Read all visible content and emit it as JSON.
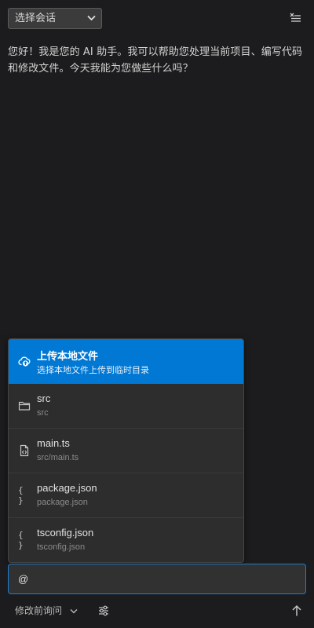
{
  "header": {
    "session_select": {
      "selected": "选择会话"
    },
    "clear_icon": "clear-all-icon"
  },
  "messages": [
    {
      "role": "assistant",
      "text": "您好！我是您的 AI 助手。我可以帮助您处理当前项目、编写代码和修改文件。今天我能为您做些什么吗？"
    }
  ],
  "popup": {
    "items": [
      {
        "title": "上传本地文件",
        "subtitle": "选择本地文件上传到临时目录",
        "icon": "cloud-upload-icon",
        "selected": true
      },
      {
        "title": "src",
        "subtitle": "src",
        "icon": "folder-icon"
      },
      {
        "title": "main.ts",
        "subtitle": "src/main.ts",
        "icon": "file-code-icon"
      },
      {
        "title": "package.json",
        "subtitle": "package.json",
        "icon": "json-icon",
        "glyph": "{ }"
      },
      {
        "title": "tsconfig.json",
        "subtitle": "tsconfig.json",
        "icon": "json-icon",
        "glyph": "{ }"
      }
    ]
  },
  "input": {
    "value": "@"
  },
  "footer": {
    "mode_select": "修改前询问",
    "settings_icon": "settings-sliders-icon",
    "send_icon": "arrow-up-icon"
  },
  "colors": {
    "background": "#1c1c1e",
    "accent": "#0078d4",
    "popup_bg": "#2d2d2d",
    "input_border": "#1d7fd1"
  }
}
